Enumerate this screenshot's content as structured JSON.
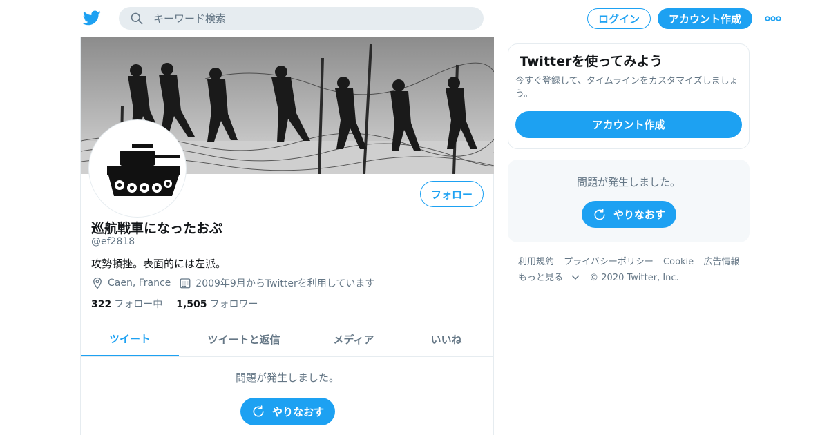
{
  "header": {
    "search_placeholder": "キーワード検索",
    "login_label": "ログイン",
    "signup_label": "アカウント作成"
  },
  "profile": {
    "display_name": "巡航戦車になったおぷ",
    "handle": "@ef2818",
    "bio": "攻勢頓挫。表面的には左派。",
    "location": "Caen, France",
    "joined": "2009年9月からTwitterを利用しています",
    "following_count": "322",
    "following_label": "フォロー中",
    "followers_count": "1,505",
    "followers_label": "フォロワー",
    "follow_button": "フォロー"
  },
  "tabs": [
    {
      "label": "ツイート",
      "active": true
    },
    {
      "label": "ツイートと返信",
      "active": false
    },
    {
      "label": "メディア",
      "active": false
    },
    {
      "label": "いいね",
      "active": false
    }
  ],
  "timeline": {
    "error_message": "問題が発生しました。",
    "retry_label": "やりなおす"
  },
  "sidebar": {
    "signup_card": {
      "title": "Twitterを使ってみよう",
      "description": "今すぐ登録して、タイムラインをカスタマイズしましょう。",
      "button": "アカウント作成"
    },
    "error_card": {
      "message": "問題が発生しました。",
      "retry_label": "やりなおす"
    },
    "footer": {
      "links": [
        "利用規約",
        "プライバシーポリシー",
        "Cookie",
        "広告情報"
      ],
      "more": "もっと見る",
      "copyright": "© 2020 Twitter, Inc."
    }
  },
  "colors": {
    "accent": "#1da1f2",
    "text_secondary": "#657786",
    "border": "#e6ecf0"
  },
  "icons": {
    "logo": "twitter-bird-icon",
    "search": "search-icon",
    "more": "more-dots-icon",
    "location": "location-pin-icon",
    "calendar": "calendar-icon",
    "retry": "refresh-icon",
    "chevron": "chevron-down-icon"
  }
}
